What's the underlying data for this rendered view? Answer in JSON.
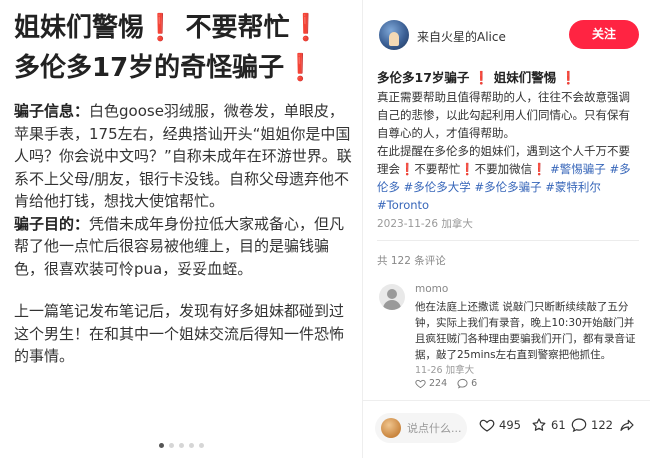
{
  "note_image": {
    "headline_line1": "姐妹们警惕",
    "headline_line1_b": "不要帮忙",
    "headline_line2": "多伦多17岁的奇怪骗子",
    "mark": "❗",
    "info_label": "骗子信息：",
    "info_text": "白色goose羽绒服，微卷发，单眼皮，苹果手表，175左右，经典搭讪开头“姐姐你是中国人吗？你会说中文吗？”自称未成年在环游世界。联系不上父母/朋友，银行卡没钱。自称父母遗弃他不肯给他打钱，想找大使馆帮忙。",
    "purpose_label": "骗子目的：",
    "purpose_text": "凭借未成年身份拉低大家戒备心，但凡帮了他一点忙后很容易被他缠上，目的是骗钱骗色，很喜欢装可怜pua，妥妥血蛭。",
    "closing_text": "上一篇笔记发布笔记后，发现有好多姐妹都碰到过这个男生！在和其中一个姐妹交流后得知一件恐怖的事情。"
  },
  "author": {
    "name": "来自火星的Alice",
    "follow_label": "关注"
  },
  "note": {
    "title_a": "多伦多17岁骗子",
    "title_b": "姐妹们警惕",
    "mark": "❗",
    "desc_a": "真正需要帮助且值得帮助的人，往往不会故意强调自己的悲惨，以此勾起利用人们同情心。只有保有自尊心的人，才值得帮助。",
    "desc_b": "在此提醒在多伦多的姐妹们，遇到这个人千万不要理会",
    "desc_c": "不要帮忙",
    "desc_d": "不要加微信",
    "tags": [
      "#警惕骗子",
      "#多伦多",
      "#多伦多大学",
      "#多伦多骗子",
      "#蒙特利尔",
      "#Toronto"
    ],
    "date": "2023-11-26 加拿大"
  },
  "comments": {
    "count_label": "共 122 条评论",
    "items": [
      {
        "name": "momo",
        "text": "他在法庭上还撒谎 说敲门只断断续续敲了五分钟，实际上我们有录音，晚上10:30开始敲门并且疯狂贼门各种理由要骗我们开门，都有录音证据，敲了25mins左右直到警察把他抓住。",
        "date": "11-26 加拿大",
        "likes": "224",
        "replies": "6"
      }
    ]
  },
  "bottom_bar": {
    "input_placeholder": "说点什么...",
    "likes": "495",
    "collects": "61",
    "comments": "122"
  },
  "colors": {
    "accent": "#ff2442",
    "mark": "#e8243c",
    "tag": "#3766b9"
  }
}
